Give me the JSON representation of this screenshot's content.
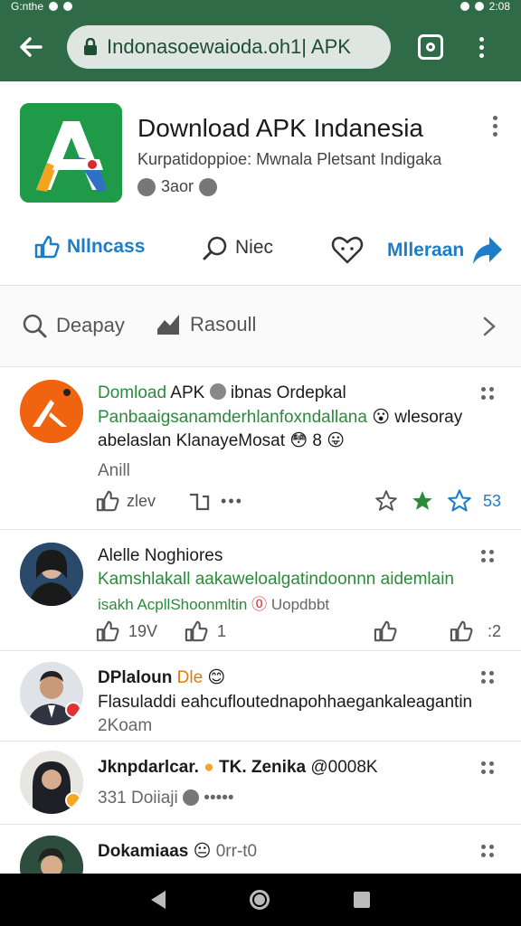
{
  "status": {
    "left": "G:nthe",
    "right": "2:08"
  },
  "toolbar": {
    "url": "Indonasoewaioda.oh1| APK"
  },
  "app": {
    "title": "Download APK Indanesia",
    "subtitle": "Kurpatidoppioe: Mwnala Pletsant Indigaka",
    "meta": "3aor",
    "actions": {
      "like": "Nllncass",
      "comment": "Niec",
      "share": "Mlleraan"
    }
  },
  "filters": {
    "display": "Deapay",
    "result": "Rasoull"
  },
  "posts": [
    {
      "name_a": "Domload",
      "name_b": "APK",
      "name_c": "ibnas Ordepkal",
      "line1": "Panbaaigsanamderhlanfoxndallana",
      "line1_b": "wlesoray",
      "line2": "abelaslan KlanayeMosat",
      "line2_b": "8",
      "line3": "Anill",
      "action_count": "zlev",
      "star_count": "53"
    },
    {
      "name": "Alelle Noghiores",
      "line1": "Kamshlakall aakaweloalgatindoonnn aidemlain",
      "line2a": "isakh AcpllShoonmltin",
      "line2b": "Uopdbbt",
      "count1": "19V",
      "count2": "1",
      "count3": ":2"
    },
    {
      "name": "DPlaloun",
      "name_tag": "Dle",
      "line1": "Flasuladdi eahcufloutednapohhaegankaleagantin",
      "line2": "2Koam"
    },
    {
      "name": "Jknpdarlcar.",
      "name_b": "TK. Zenika",
      "name_c": "@0008K",
      "line1": "331 Doiiaji",
      "line1_b": "•••••"
    },
    {
      "name": "Dokamiaas",
      "name_b": "0rr-t0"
    }
  ],
  "colors": {
    "toolbar": "#2e6b46",
    "accent": "#1c7ec8",
    "green": "#2c8a3b"
  }
}
